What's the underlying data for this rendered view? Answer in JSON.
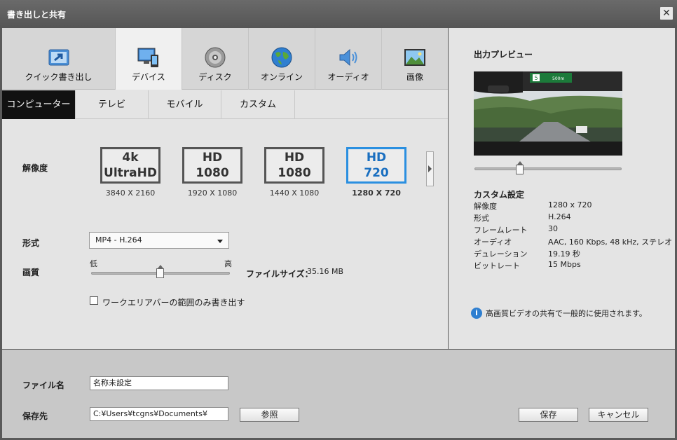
{
  "window": {
    "title": "書き出しと共有",
    "close": "✕"
  },
  "main_tabs": [
    {
      "label": "クイック書き出し",
      "icon": "quick-export-icon"
    },
    {
      "label": "デバイス",
      "icon": "device-icon"
    },
    {
      "label": "ディスク",
      "icon": "disc-icon"
    },
    {
      "label": "オンライン",
      "icon": "globe-icon"
    },
    {
      "label": "オーディオ",
      "icon": "speaker-icon"
    },
    {
      "label": "画像",
      "icon": "image-icon"
    }
  ],
  "sub_tabs": [
    "コンピューター",
    "テレビ",
    "モバイル",
    "カスタム"
  ],
  "resolution": {
    "label": "解像度",
    "options": [
      {
        "line1": "4k",
        "line2": "UltraHD",
        "caption": "3840 X 2160",
        "selected": false
      },
      {
        "line1": "HD",
        "line2": "1080",
        "caption": "1920 X 1080",
        "selected": false
      },
      {
        "line1": "HD",
        "line2": "1080",
        "caption": "1440 X 1080",
        "selected": false
      },
      {
        "line1": "HD",
        "line2": "720",
        "caption": "1280 X 720",
        "selected": true
      }
    ]
  },
  "format": {
    "label": "形式",
    "value": "MP4 - H.264"
  },
  "quality": {
    "label": "画質",
    "low": "低",
    "high": "高",
    "level": 0.5
  },
  "file_size": {
    "label": "ファイルサイズ：",
    "value": "35.16 MB"
  },
  "work_area_checkbox": {
    "label": "ワークエリアバーの範囲のみ書き出す",
    "checked": false
  },
  "preview": {
    "title": "出力プレビュー",
    "scrub_position": 0.31,
    "sign_number": "5",
    "sign_text": "500m"
  },
  "custom_settings": {
    "title": "カスタム設定",
    "rows": [
      {
        "key": "解像度",
        "value": "1280 x 720"
      },
      {
        "key": "形式",
        "value": "H.264"
      },
      {
        "key": "フレームレート",
        "value": "30"
      },
      {
        "key": "オーディオ",
        "value": "AAC, 160 Kbps, 48 kHz, ステレオ"
      },
      {
        "key": "デュレーション",
        "value": "19.19 秒"
      },
      {
        "key": "ビットレート",
        "value": "15 Mbps"
      }
    ]
  },
  "info_note": "高画質ビデオの共有で一般的に使用されます。",
  "bottom": {
    "filename_label": "ファイル名",
    "filename_value": "名称未設定",
    "save_to_label": "保存先",
    "save_to_value": "C:¥Users¥tcgns¥Documents¥",
    "browse_label": "参照",
    "save_label": "保存",
    "cancel_label": "キャンセル"
  },
  "colors": {
    "selected_accent": "#2a8fe0",
    "info_blue": "#2f7fd0"
  }
}
